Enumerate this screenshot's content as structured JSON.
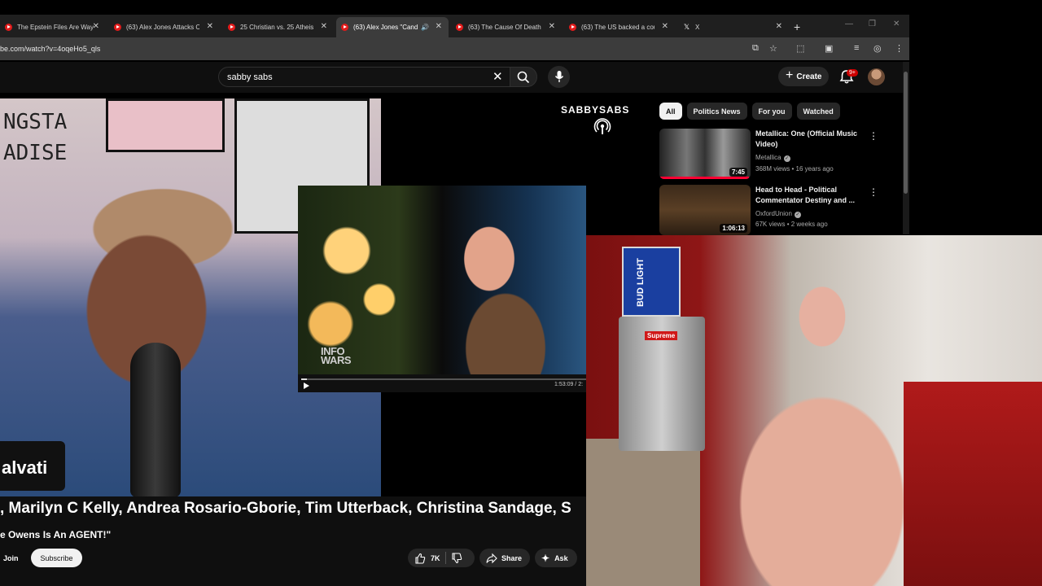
{
  "browser": {
    "tabs": [
      {
        "title": "The Epstein Files Are Way",
        "active": false,
        "favicon": "youtube"
      },
      {
        "title": "(63) Alex Jones Attacks Ca",
        "active": false,
        "favicon": "youtube"
      },
      {
        "title": "25 Christian vs. 25 Atheist",
        "active": false,
        "favicon": "youtube"
      },
      {
        "title": "(63) Alex Jones \"Cand",
        "active": true,
        "favicon": "youtube",
        "audio": true
      },
      {
        "title": "(63) The Cause Of Death",
        "active": false,
        "favicon": "youtube"
      },
      {
        "title": "(63) The US backed a cou",
        "active": false,
        "favicon": "youtube"
      },
      {
        "title": "X",
        "active": false,
        "favicon": "x"
      }
    ],
    "url": "be.com/watch?v=4oqeHo5_qls",
    "icons": [
      "install-icon",
      "star-icon",
      "extensions-icon",
      "split-icon",
      "media-icon",
      "profile-icon",
      "menu-icon"
    ]
  },
  "youtube": {
    "search": {
      "value": "sabby sabs"
    },
    "create_label": "Create",
    "notification_count": "9+",
    "brand_text": "SABBYSABS",
    "overlay_name": "alvati",
    "collaborators": ", Marilyn C Kelly, Andrea Rosario-Gborie, Tim Utterback, Christina Sandage, S",
    "video_title": "e Owens Is An AGENT!\"",
    "join_label": "Join",
    "subscribe_label": "Subscribe",
    "like_count": "7K",
    "share_label": "Share",
    "ask_label": "Ask",
    "clip": {
      "logo_top": "INFO",
      "logo_bottom": "WARS",
      "time": "1:53:09 / 2:",
      "progress": 0.02
    },
    "chips": [
      "All",
      "Politics News",
      "For you",
      "Watched"
    ],
    "active_chip": "All",
    "recommendations": [
      {
        "title": "Metallica: One (Official Music Video)",
        "channel": "Metallica",
        "views": "368M views",
        "age": "16 years ago",
        "duration": "7:45",
        "watched": 0.98
      },
      {
        "title": "Head to Head - Political Commentator Destiny and ...",
        "channel": "OxfordUnion",
        "views": "67K views",
        "age": "2 weeks ago",
        "duration": "1:06:13",
        "watched": 0
      }
    ]
  },
  "webcam": {
    "labels": [
      "BUD LIGHT",
      "Supreme"
    ]
  },
  "colors": {
    "accent": "#ff0033",
    "chip_active": "#f1f1f1",
    "badge": "#cc0000"
  }
}
